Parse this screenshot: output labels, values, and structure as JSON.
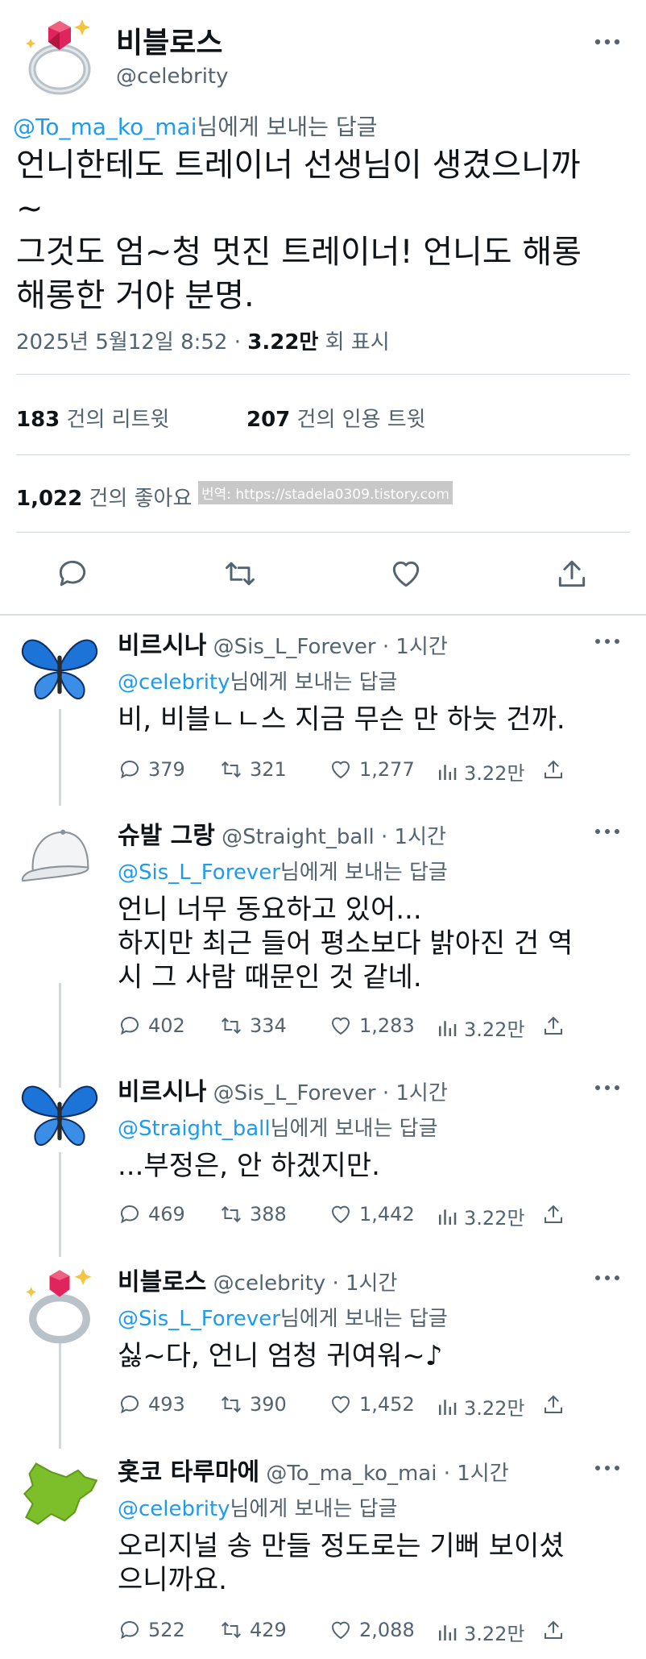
{
  "main": {
    "display_name": "비블로스",
    "handle": "@celebrity",
    "reply_to_handle": "@To_ma_ko_mai",
    "reply_to_suffix": "님에게 보내는 답글",
    "text": "언니한테도 트레이너 선생님이 생겼으니까\n~\n그것도 엄~청 멋진 트레이너! 언니도 해롱\n해롱한 거야 분명.",
    "date": "2025년 5월12일  8:52",
    "separator": "·",
    "views_count": "3.22만",
    "views_label": "회 표시",
    "retweets_count": "183",
    "retweets_label": "건의 리트윗",
    "quotes_count": "207",
    "quotes_label": "건의 인용 트윗",
    "likes_count": "1,022",
    "likes_label": "건의 좋아요",
    "watermark": "번역: https://stadela0309.tistory.com"
  },
  "icons": {
    "more": "more-dots-icon",
    "reply": "reply-bubble-icon",
    "retweet": "retweet-icon",
    "like": "heart-icon",
    "share": "share-upload-icon",
    "views": "views-bar-chart-icon"
  },
  "colors": {
    "link": "#1d9bf0",
    "secondary": "#536471",
    "text": "#0f1419"
  },
  "replies": [
    {
      "display_name": "비르시나",
      "handle": "@Sis_L_Forever",
      "time": "· 1시간",
      "reply_to_handle": "@celebrity",
      "reply_to_suffix": "님에게 보내는 답글",
      "text": "비, 비블ㄴㄴ스 지금 무슨 만 하늣 건까.",
      "replies": "379",
      "retweets": "321",
      "likes": "1,277",
      "views": "3.22만",
      "avatar": "butterfly"
    },
    {
      "display_name": "슈발 그랑",
      "handle": "@Straight_ball",
      "time": "· 1시간",
      "reply_to_handle": "@Sis_L_Forever",
      "reply_to_suffix": "님에게 보내는 답글",
      "text": "언니 너무 동요하고 있어...\n하지만 최근 들어 평소보다 밝아진 건 역\n시 그 사람 때문인 것 같네.",
      "replies": "402",
      "retweets": "334",
      "likes": "1,283",
      "views": "3.22만",
      "avatar": "cap"
    },
    {
      "display_name": "비르시나",
      "handle": "@Sis_L_Forever",
      "time": "· 1시간",
      "reply_to_handle": "@Straight_ball",
      "reply_to_suffix": "님에게 보내는 답글",
      "text": "...부정은, 안 하겠지만.",
      "replies": "469",
      "retweets": "388",
      "likes": "1,442",
      "views": "3.22만",
      "avatar": "butterfly"
    },
    {
      "display_name": "비블로스",
      "handle": "@celebrity",
      "time": "· 1시간",
      "reply_to_handle": "@Sis_L_Forever",
      "reply_to_suffix": "님에게 보내는 답글",
      "text": "싫~다, 언니 엄청 귀여워~♪",
      "replies": "493",
      "retweets": "390",
      "likes": "1,452",
      "views": "3.22만",
      "avatar": "ring"
    },
    {
      "display_name": "홋코 타루마에",
      "handle": "@To_ma_ko_mai",
      "time": "· 1시간",
      "reply_to_handle": "@celebrity",
      "reply_to_suffix": "님에게 보내는 답글",
      "text": "오리지널 송 만들 정도로는 기뻐 보이셨\n으니까요.",
      "replies": "522",
      "retweets": "429",
      "likes": "2,088",
      "views": "3.22만",
      "avatar": "map"
    }
  ]
}
